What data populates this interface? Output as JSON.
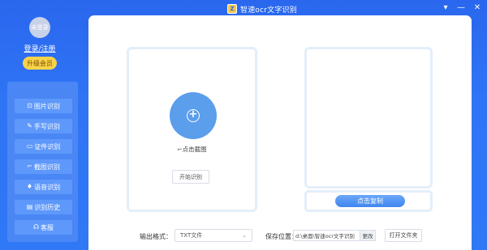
{
  "window": {
    "title": "智速ocr文字识别",
    "logo_text": "Z",
    "controls": {
      "menu": "▾",
      "minimize": "—",
      "close": "✕"
    }
  },
  "sidebar": {
    "avatar_text": "未登录",
    "login_label": "登录/注册",
    "vip_label": "升级会员",
    "items": [
      {
        "icon": "⊡",
        "icon_name": "image-icon",
        "label": "图片识别"
      },
      {
        "icon": "✎",
        "icon_name": "pen-icon",
        "label": "手写识别"
      },
      {
        "icon": "▭",
        "icon_name": "id-card-icon",
        "label": "证件识别"
      },
      {
        "icon": "⌐",
        "icon_name": "crop-icon",
        "label": "截图识别"
      },
      {
        "icon": "♦",
        "icon_name": "mic-icon",
        "label": "语音识别"
      },
      {
        "icon": "▤",
        "icon_name": "history-icon",
        "label": "识别历史"
      },
      {
        "icon": "☊",
        "icon_name": "headset-icon",
        "label": "客服"
      }
    ]
  },
  "main": {
    "add_icon": "+",
    "capture_label": "⌐点击截图",
    "start_button": "开始识别",
    "copy_button": "点击复制",
    "format_label": "输出格式：",
    "format_value": "TXT文件",
    "format_chevron": "⌄",
    "save_label": "保存位置：",
    "save_path": "d:\\桌面\\智速ocr文字识别",
    "change_button": "更改",
    "open_folder_button": "打开文件夹"
  },
  "colors": {
    "brand_blue": "#2f74f5",
    "accent_button": "#5b9eec",
    "vip_yellow": "#f8d34a"
  }
}
